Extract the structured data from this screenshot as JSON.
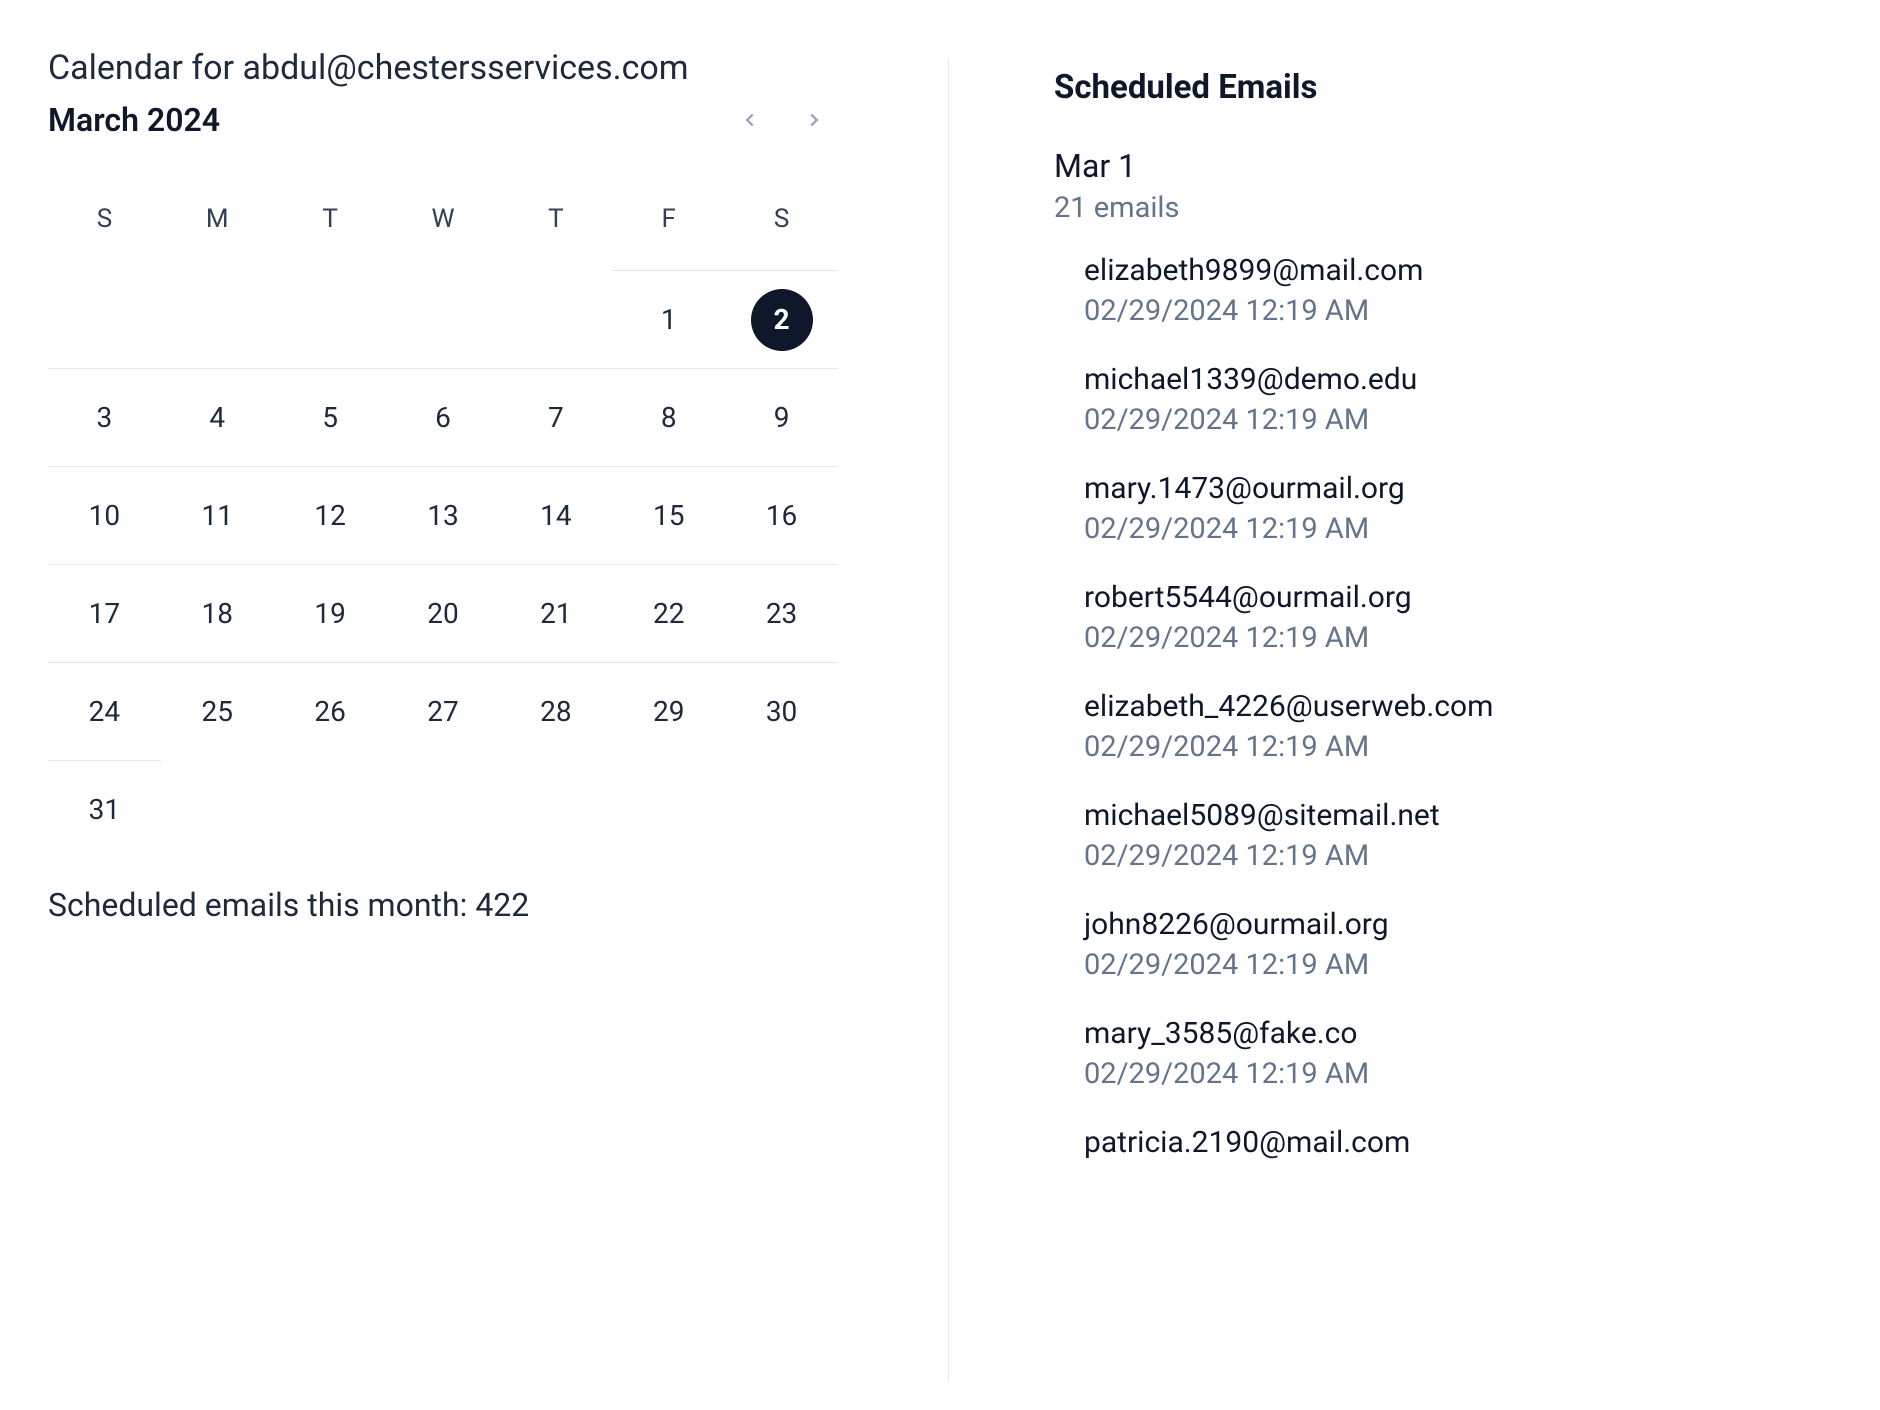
{
  "header": {
    "page_title": "Calendar for abdul@chestersservices.com",
    "month_label": "March 2024"
  },
  "calendar": {
    "dow": [
      "S",
      "M",
      "T",
      "W",
      "T",
      "F",
      "S"
    ],
    "leading_blanks": 5,
    "days": [
      1,
      2,
      3,
      4,
      5,
      6,
      7,
      8,
      9,
      10,
      11,
      12,
      13,
      14,
      15,
      16,
      17,
      18,
      19,
      20,
      21,
      22,
      23,
      24,
      25,
      26,
      27,
      28,
      29,
      30,
      31
    ],
    "today": 2,
    "summary_prefix": "Scheduled emails this month: ",
    "summary_count": "422"
  },
  "scheduled": {
    "title": "Scheduled Emails",
    "date_label": "Mar 1",
    "count_label": "21 emails",
    "emails": [
      {
        "address": "elizabeth9899@mail.com",
        "ts": "02/29/2024 12:19 AM"
      },
      {
        "address": "michael1339@demo.edu",
        "ts": "02/29/2024 12:19 AM"
      },
      {
        "address": "mary.1473@ourmail.org",
        "ts": "02/29/2024 12:19 AM"
      },
      {
        "address": "robert5544@ourmail.org",
        "ts": "02/29/2024 12:19 AM"
      },
      {
        "address": "elizabeth_4226@userweb.com",
        "ts": "02/29/2024 12:19 AM"
      },
      {
        "address": "michael5089@sitemail.net",
        "ts": "02/29/2024 12:19 AM"
      },
      {
        "address": "john8226@ourmail.org",
        "ts": "02/29/2024 12:19 AM"
      },
      {
        "address": "mary_3585@fake.co",
        "ts": "02/29/2024 12:19 AM"
      },
      {
        "address": "patricia.2190@mail.com",
        "ts": ""
      }
    ]
  }
}
